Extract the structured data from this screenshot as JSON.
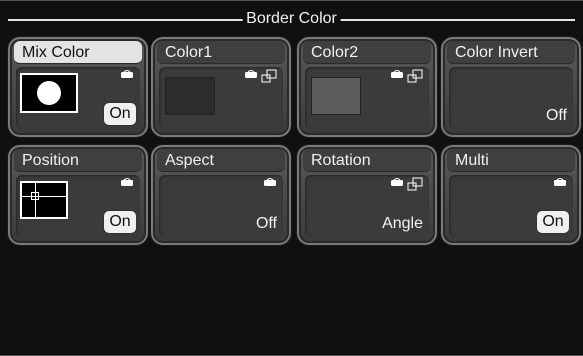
{
  "title": "Border Color",
  "colors": {
    "color1_swatch": "#2c2c2c",
    "color2_swatch": "#5c5c5c"
  },
  "tiles": [
    {
      "label": "Mix Color",
      "value": "On",
      "selected": true
    },
    {
      "label": "Color1"
    },
    {
      "label": "Color2"
    },
    {
      "label": "Color Invert",
      "value": "Off"
    },
    {
      "label": "Position",
      "value": "On"
    },
    {
      "label": "Aspect",
      "value": "Off"
    },
    {
      "label": "Rotation",
      "value": "Angle"
    },
    {
      "label": "Multi",
      "value": "On"
    }
  ]
}
